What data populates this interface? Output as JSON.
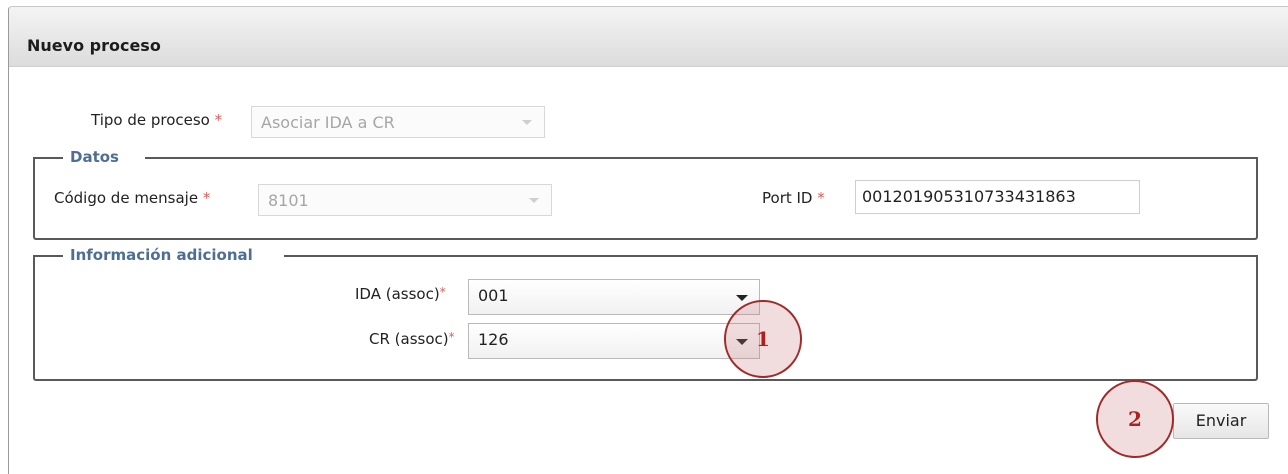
{
  "panel": {
    "title": "Nuevo proceso"
  },
  "tipo_proceso": {
    "label": "Tipo de proceso",
    "required": "*",
    "value": "Asociar IDA a CR"
  },
  "datos": {
    "legend": "Datos",
    "codigo_mensaje": {
      "label": "Código de mensaje",
      "required": "*",
      "value": "8101"
    },
    "port_id": {
      "label": "Port ID",
      "required": "*",
      "value": "00120190531073343186​3"
    }
  },
  "info_adicional": {
    "legend": "Información adicional",
    "ida": {
      "label": "IDA (assoc)",
      "required": "*",
      "value": "001"
    },
    "cr": {
      "label": "CR (assoc)",
      "required": "*",
      "value": "126"
    }
  },
  "actions": {
    "submit_label": "Enviar"
  },
  "callouts": {
    "one": "1",
    "two": "2"
  },
  "colors": {
    "legend": "#4e6f93",
    "required": "#e05a5a",
    "callout": "#a02a2a"
  }
}
